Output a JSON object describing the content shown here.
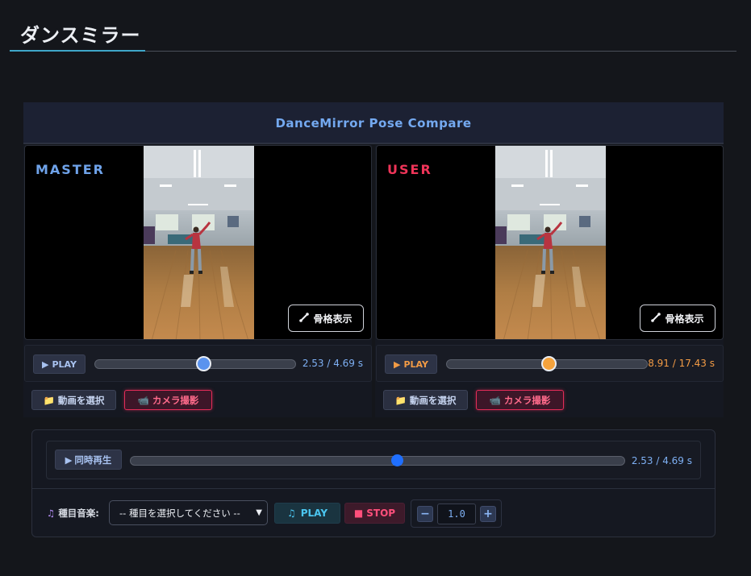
{
  "page": {
    "title": "ダンスミラー"
  },
  "app": {
    "title": "DanceMirror Pose Compare"
  },
  "master": {
    "label": "MASTER",
    "skeleton_label": "骨格表示",
    "play_label": "PLAY",
    "time": "2.53 / 4.69 s",
    "progress": 0.54,
    "select_label": "動画を選択",
    "camera_label": "カメラ撮影",
    "accent": "#5b93ee"
  },
  "user": {
    "label": "USER",
    "skeleton_label": "骨格表示",
    "play_label": "PLAY",
    "time": "8.91 / 17.43 s",
    "progress": 0.51,
    "select_label": "動画を選択",
    "camera_label": "カメラ撮影",
    "accent": "#f4a23c"
  },
  "sync": {
    "play_label": "同時再生",
    "time": "2.53 / 4.69 s",
    "progress": 0.54
  },
  "music": {
    "label": "種目音楽:",
    "select_value": "-- 種目を選択してください --",
    "play_label": "PLAY",
    "stop_label": "STOP",
    "speed_minus": "−",
    "speed_value": "1.0",
    "speed_plus": "+"
  }
}
